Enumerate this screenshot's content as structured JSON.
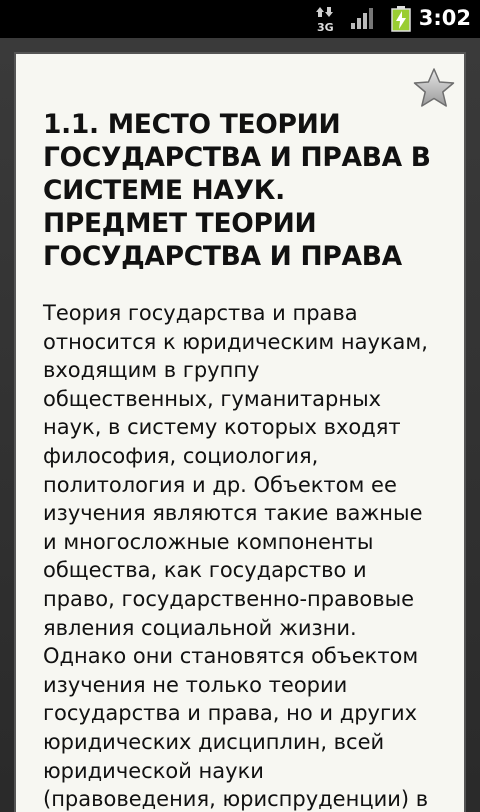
{
  "status_bar": {
    "time": "3:02",
    "network_type": "3G",
    "icons": [
      "data-arrows-icon",
      "signal-icon",
      "battery-charging-icon"
    ]
  },
  "article": {
    "favorite_icon": "star-icon",
    "title": "1.1. МЕСТО ТЕОРИИ ГОСУДАРСТВА И ПРАВА В СИСТЕМЕ НАУК. ПРЕДМЕТ ТЕОРИИ ГОСУДАРСТВА И ПРАВА",
    "body": "Теория государства и права\nотносится к юридическим наукам,\nвходящим в группу\nобщественных, гуманитарных\nнаук, в систему которых входят\nфилософия, социология,\nполитология и др. Объектом ее\nизучения являются такие важные\nи многосложные компоненты\nобщества, как государство и\nправо, государственно-правовые\nявления социальной жизни.\nОднако они становятся объектом\nизучения не только теории\nгосударства и права, но и других\nюридических дисциплин, всей\nюридической науки\n(правоведения, юриспруденции) в"
  }
}
